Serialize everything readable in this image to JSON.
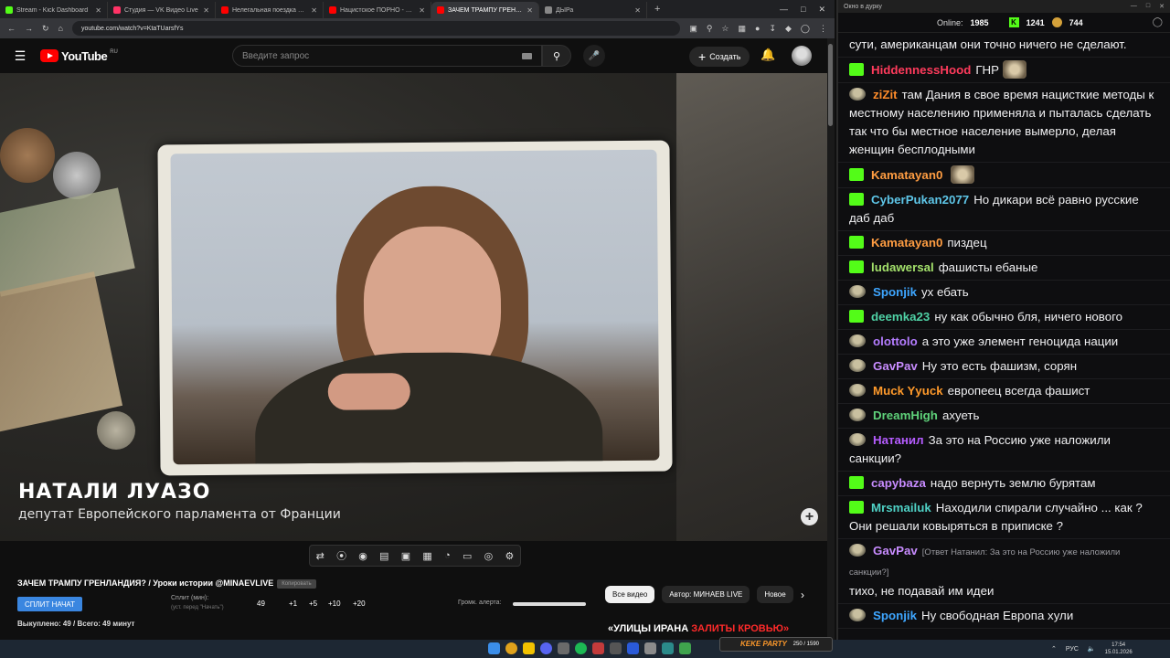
{
  "browser": {
    "tabs": [
      {
        "title": "Stream - Kick Dashboard",
        "color": "#53fc18"
      },
      {
        "title": "Студия — VK Видео Live",
        "color": "#ff3366"
      },
      {
        "title": "Нелегальная поездка в Сири…",
        "color": "#ff0000"
      },
      {
        "title": "Нацистское ПОРНО - обзор о…",
        "color": "#ff0000"
      },
      {
        "title": "ЗАЧЕМ ТРАМПУ ГРЕНЛАН…",
        "color": "#ff0000",
        "active": true
      },
      {
        "title": "ДЫРа",
        "color": "#888888"
      }
    ],
    "url": "youtube.com/watch?v=KtaTUarsfYs"
  },
  "youtube": {
    "region": "RU",
    "search_placeholder": "Введите запрос",
    "create_label": "Создать"
  },
  "video": {
    "lower_third_name": "НАТАЛИ ЛУАЗО",
    "lower_third_role": "депутат Европейского парламента от Франции"
  },
  "toolbar_icons": [
    "loop-icon",
    "cast-icon",
    "watch-icon",
    "clip-icon",
    "pip-icon",
    "film-icon",
    "speed-icon",
    "screen-icon",
    "screenshot-icon",
    "settings-icon"
  ],
  "panel": {
    "title": "ЗАЧЕМ ТРАМПУ ГРЕНЛАНДИЯ? / Уроки истории @MINAEVLIVE",
    "title_badge": "Копировать",
    "split_button": "СПЛИТ НАЧАТ",
    "split_label": "Сплит (мин):",
    "split_hint": "(уст. перед \"Начать\")",
    "split_value": "49",
    "increments": [
      "+1",
      "+5",
      "+10",
      "+20"
    ],
    "bought": "Выкуплено: 49 / Всего: 49 минут",
    "volume_label": "Громк. алерта:",
    "volume_level": 1.0
  },
  "chips": [
    "Все видео",
    "Автор: МИНАЕВ LIVE",
    "Новое"
  ],
  "recommendation": {
    "part1": "«УЛИЦЫ ИРАНА",
    "part2": "ЗАЛИТЫ КРОВЬЮ»"
  },
  "chat": {
    "window_title": "Окно в дурку",
    "online_label": "Online:",
    "online_count": "1985",
    "kick_count": "1241",
    "coin_count": "744",
    "messages": [
      {
        "user": "",
        "color": "#ffffff",
        "source": "none",
        "text": "сути, американцам они точно ничего не сделают."
      },
      {
        "user": "HiddennessHood",
        "color": "#ff3b5c",
        "source": "k",
        "text": "ГНР",
        "emote": true
      },
      {
        "user": "ziZit",
        "color": "#ff8c2a",
        "source": "s",
        "text": "там Дания в свое время нацисткие методы к местному населению применяла и пыталась сделать так что бы местное население вымерло, делая женщин бесплодными"
      },
      {
        "user": "Kamatayan0",
        "color": "#ff9d42",
        "source": "k",
        "text": "",
        "emote": true
      },
      {
        "user": "CyberPukan2077",
        "color": "#5ec6e8",
        "source": "k",
        "text": "Но дикари всё равно русские даб даб"
      },
      {
        "user": "Kamatayan0",
        "color": "#ff9d42",
        "source": "k",
        "text": "пиздец"
      },
      {
        "user": "ludawersal",
        "color": "#a3e06b",
        "source": "k",
        "text": "фашисты ебаные"
      },
      {
        "user": "Sponjik",
        "color": "#3ea6ff",
        "source": "s",
        "text": "ух ебать"
      },
      {
        "user": "deemka23",
        "color": "#4fd1a5",
        "source": "k",
        "text": "ну как обычно бля, ничего нового"
      },
      {
        "user": "olottolo",
        "color": "#b47cff",
        "source": "s",
        "text": "а это уже элемент геноцида нации"
      },
      {
        "user": "GavPav",
        "color": "#c88cff",
        "source": "s",
        "text": "Ну это есть фашизм, сорян"
      },
      {
        "user": "Muck Yyuck",
        "color": "#ff9a2b",
        "source": "s",
        "text": "европеец всегда фашист"
      },
      {
        "user": "DreamHigh",
        "color": "#5fd27a",
        "source": "s",
        "text": "ахуеть"
      },
      {
        "user": "Натанил",
        "color": "#b55cff",
        "source": "s",
        "text": "За это на Россию уже наложили санкции?"
      },
      {
        "user": "capybaza",
        "color": "#c78bff",
        "source": "k",
        "text": "надо вернуть землю бурятам"
      },
      {
        "user": "Mrsmailuk",
        "color": "#4fd1c5",
        "source": "k",
        "text": "Находили спирали случайно ... как ? Они решали ковыряться в приписке ?"
      },
      {
        "user": "GavPav",
        "color": "#c88cff",
        "source": "s",
        "reply": "[Ответ Натанил: За это на Россию уже наложили санкции?]",
        "text": "тихо, не подавай им идеи"
      },
      {
        "user": "Sponjik",
        "color": "#3ea6ff",
        "source": "s",
        "text": "Ну свободная Европа хули"
      }
    ]
  },
  "taskbar": {
    "kick_party_brand": "KEKE PARTY",
    "kick_party_value": "250 / 1590",
    "lang": "РУС",
    "time": "17:54",
    "date": "15.01.2026"
  }
}
